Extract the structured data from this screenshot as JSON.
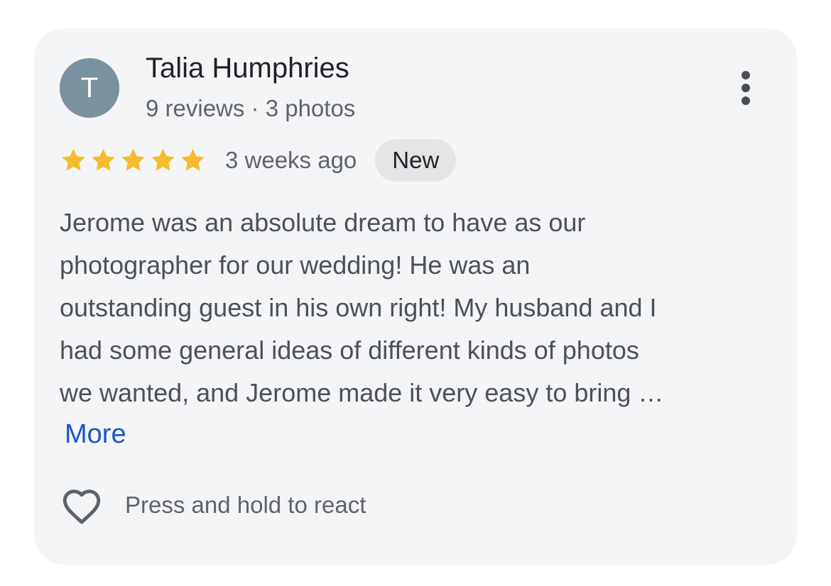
{
  "review": {
    "avatar_initial": "T",
    "reviewer_name": "Talia Humphries",
    "reviewer_meta": "9 reviews · 3 photos",
    "rating": 5,
    "rating_max": 5,
    "time_ago": "3 weeks ago",
    "badge": "New",
    "text_lines": [
      "Jerome was an absolute dream to have as our",
      "photographer for our wedding! He was an",
      "outstanding guest in his own right! My husband and I",
      "had some general ideas of different kinds of photos",
      "we wanted, and Jerome made it very easy to bring …"
    ],
    "more_label": "More",
    "react_label": "Press and hold to react"
  },
  "colors": {
    "card_background": "#f4f5f7",
    "avatar_background": "#7b919e",
    "star": "#f6bb2e",
    "link": "#1a56c9",
    "badge_background": "#e3e4e6"
  },
  "icons": {
    "menu": "more-vert-icon",
    "star": "star-icon",
    "react": "heart-outline-icon"
  }
}
